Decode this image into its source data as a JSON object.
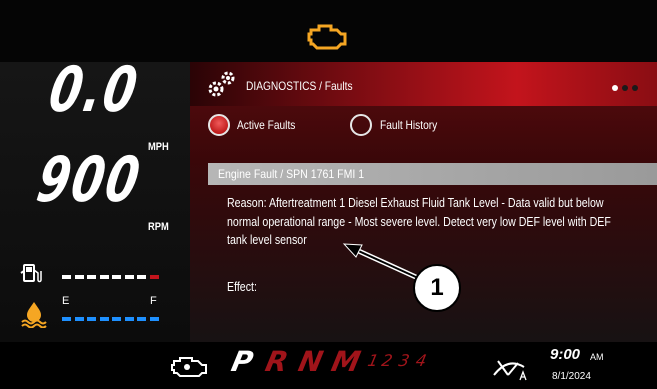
{
  "speedometer": {
    "value": "0.0",
    "unit": "MPH"
  },
  "tachometer": {
    "value": "900",
    "unit": "RPM"
  },
  "fuel_gauge": {
    "icon": "fuel-pump-icon",
    "level": 0.85
  },
  "def_gauge": {
    "icon": "def-fluid-icon",
    "empty_label": "E",
    "full_label": "F",
    "level": 1.0
  },
  "header": {
    "icon": "check-engine-icon"
  },
  "diagnostics": {
    "icon": "gears-icon",
    "title": "DIAGNOSTICS / Faults",
    "tabs": [
      {
        "label": "Active Faults",
        "selected": true
      },
      {
        "label": "Fault History",
        "selected": false
      }
    ],
    "fault": {
      "title": "Engine Fault / SPN 1761 FMI 1",
      "reason": "Reason: Aftertreatment 1 Diesel Exhaust Fluid Tank Level - Data valid but below normal operational range - Most severe level.  Detect very low DEF level with DEF tank level sensor",
      "effect": "Effect:"
    },
    "callout_number": "1"
  },
  "bottom_bar": {
    "gears": [
      "P",
      "R",
      "N",
      "M"
    ],
    "gear_numbers": [
      "1",
      "2",
      "3",
      "4"
    ],
    "time": "9:00",
    "ampm": "AM",
    "date": "8/1/2024"
  },
  "colors": {
    "accent_red": "#c3141c",
    "fuel_bar": "#ffffff",
    "def_bar": "#1e90ff",
    "warning_orange": "#f5a623"
  }
}
